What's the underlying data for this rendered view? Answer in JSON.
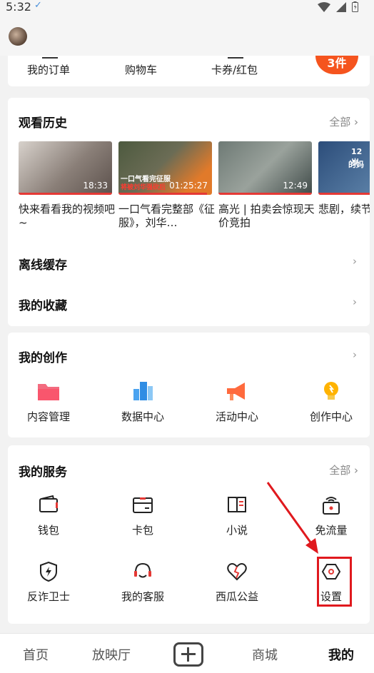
{
  "status": {
    "time": "5:32"
  },
  "quick": {
    "orders": "我的订单",
    "cart": "购物车",
    "coupons": "卡券/红包",
    "badge": "3件"
  },
  "history": {
    "title": "观看历史",
    "more": "全部 ›",
    "videos": [
      {
        "duration": "18:33",
        "title": "快来看看我的视频吧~",
        "progress": 1.0
      },
      {
        "duration": "01:25:27",
        "title": "一口气看完整部《征服》，刘华…",
        "progress": 0.95,
        "overlay1": "一口气看完征服",
        "overlay2": "将被刘华强砍后"
      },
      {
        "duration": "12:49",
        "title": "高光 | 拍卖会惊现天价竞拍",
        "progress": 1.0
      },
      {
        "duration": "",
        "title": "悲剧，续节年人的教育",
        "progress": 1.0,
        "overlay1": "12岁",
        "overlay2": "的妈"
      }
    ]
  },
  "offline": {
    "title": "离线缓存"
  },
  "favorites": {
    "title": "我的收藏"
  },
  "creation": {
    "title": "我的创作",
    "items": [
      {
        "label": "内容管理",
        "icon": "folder-icon"
      },
      {
        "label": "数据中心",
        "icon": "chart-icon"
      },
      {
        "label": "活动中心",
        "icon": "megaphone-icon"
      },
      {
        "label": "创作中心",
        "icon": "lightbulb-icon"
      }
    ]
  },
  "services": {
    "title": "我的服务",
    "more": "全部 ›",
    "items": [
      {
        "label": "钱包",
        "icon": "wallet-icon"
      },
      {
        "label": "卡包",
        "icon": "card-icon"
      },
      {
        "label": "小说",
        "icon": "book-icon"
      },
      {
        "label": "免流量",
        "icon": "wifi-sim-icon"
      },
      {
        "label": "反诈卫士",
        "icon": "shield-icon"
      },
      {
        "label": "我的客服",
        "icon": "headset-icon"
      },
      {
        "label": "西瓜公益",
        "icon": "heart-icon"
      },
      {
        "label": "设置",
        "icon": "gear-icon"
      }
    ]
  },
  "nav": {
    "home": "首页",
    "theater": "放映厅",
    "mall": "商城",
    "mine": "我的"
  }
}
